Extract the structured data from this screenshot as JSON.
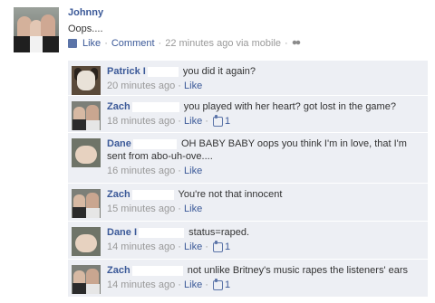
{
  "post": {
    "author": "Johnny",
    "text": "Oops....",
    "like_label": "Like",
    "comment_label": "Comment",
    "sep": "·",
    "time": "22 minutes ago via mobile",
    "audience_icon": "people-icon"
  },
  "comments": [
    {
      "name": "Patrick I",
      "text": "you did it again?",
      "time": "20 minutes ago",
      "like_label": "Like",
      "likes": "",
      "avatar": "dog"
    },
    {
      "name": "Zach",
      "text": "you played with her heart? got lost in the game?",
      "time": "18 minutes ago",
      "like_label": "Like",
      "likes": "1",
      "avatar": "couple"
    },
    {
      "name": "Dane",
      "text": "OH BABY BABY oops you think I'm in love, that I'm sent from abo-uh-ove....",
      "time": "16 minutes ago",
      "like_label": "Like",
      "likes": "",
      "avatar": "baby"
    },
    {
      "name": "Zach",
      "text": "You're not that innocent",
      "time": "15 minutes ago",
      "like_label": "Like",
      "likes": "",
      "avatar": "couple"
    },
    {
      "name": "Dane I",
      "text": "status=raped.",
      "time": "14 minutes ago",
      "like_label": "Like",
      "likes": "1",
      "avatar": "baby"
    },
    {
      "name": "Zach",
      "text": "not unlike Britney's music rapes the listeners' ears",
      "time": "14 minutes ago",
      "like_label": "Like",
      "likes": "1",
      "avatar": "couple"
    }
  ],
  "colors": {
    "link": "#3b5998",
    "meta": "#999999",
    "comment_bg": "#edeff4"
  }
}
